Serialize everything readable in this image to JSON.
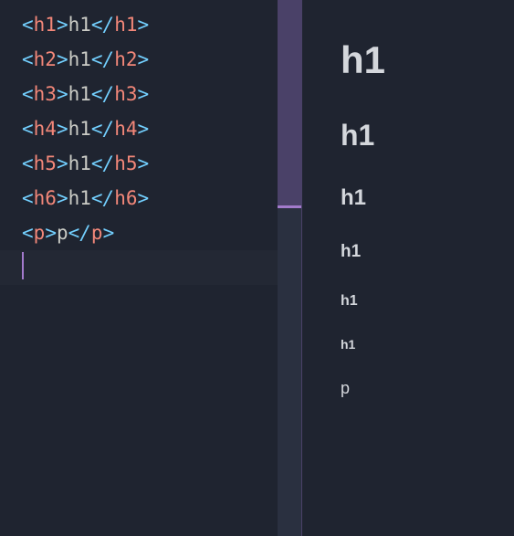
{
  "editor": {
    "lines": [
      {
        "openTag": "h1",
        "content": "h1",
        "closeTag": "h1"
      },
      {
        "openTag": "h2",
        "content": "h1",
        "closeTag": "h2"
      },
      {
        "openTag": "h3",
        "content": "h1",
        "closeTag": "h3"
      },
      {
        "openTag": "h4",
        "content": "h1",
        "closeTag": "h4"
      },
      {
        "openTag": "h5",
        "content": "h1",
        "closeTag": "h5"
      },
      {
        "openTag": "h6",
        "content": "h1",
        "closeTag": "h6"
      },
      {
        "openTag": "p",
        "content": "p",
        "closeTag": "p"
      }
    ]
  },
  "preview": {
    "h1": "h1",
    "h2": "h1",
    "h3": "h1",
    "h4": "h1",
    "h5": "h1",
    "h6": "h1",
    "p": "p"
  },
  "syntax": {
    "lt": "<",
    "gt": ">",
    "ltSlash": "</"
  }
}
